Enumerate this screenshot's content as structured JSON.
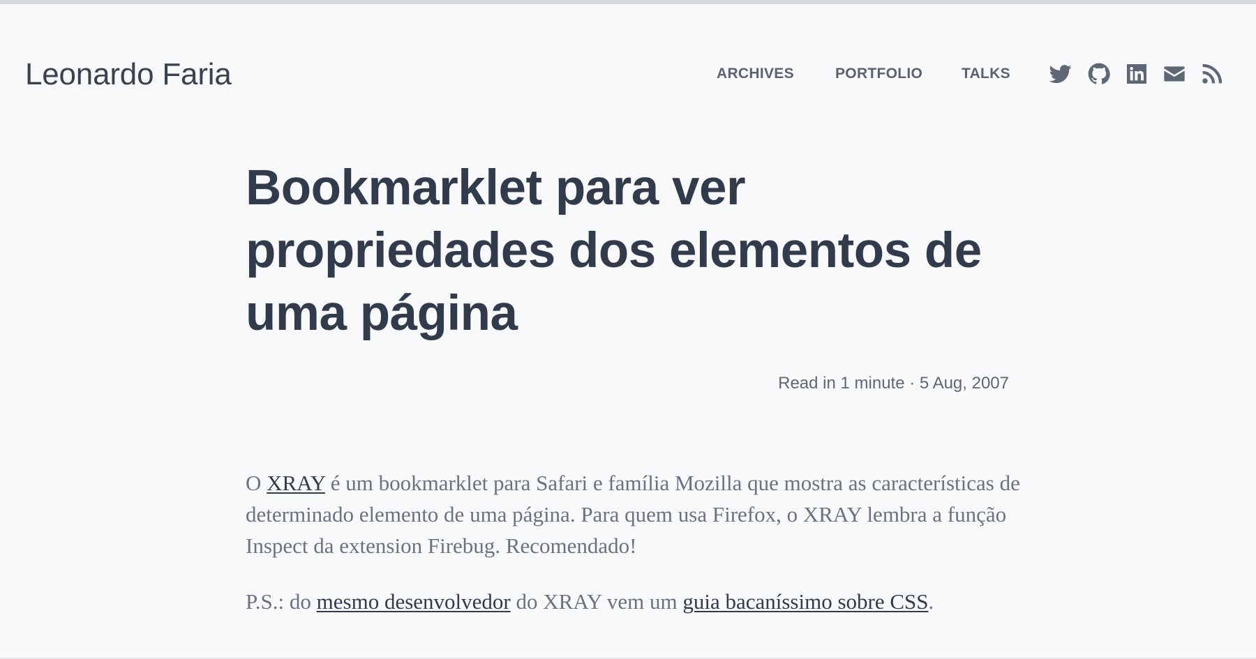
{
  "site": {
    "title": "Leonardo Faria"
  },
  "nav": {
    "archives": "ARCHIVES",
    "portfolio": "PORTFOLIO",
    "talks": "TALKS"
  },
  "social": [
    "twitter-icon",
    "github-icon",
    "linkedin-icon",
    "email-icon",
    "rss-icon"
  ],
  "colors": {
    "background": "#f8f9fb",
    "heading": "#323b4c",
    "body_text": "#6a7180",
    "nav_text": "#5a6270",
    "link": "#323b4c"
  },
  "post": {
    "title": "Bookmarklet para ver propriedades dos elementos de uma página",
    "meta": "Read in 1 minute · 5 Aug, 2007",
    "p1": {
      "pre": "O ",
      "link": "XRAY",
      "post": " é um bookmarklet para Safari e família Mozilla que mostra as características de determinado elemento de uma página. Para quem usa Firefox, o XRAY lembra a função Inspect da extension Firebug. Recomendado!"
    },
    "p2": {
      "pre": "P.S.: do ",
      "link1": "mesmo desenvolvedor",
      "mid": " do XRAY vem um ",
      "link2": "guia bacaníssimo sobre CSS",
      "end": "."
    }
  }
}
